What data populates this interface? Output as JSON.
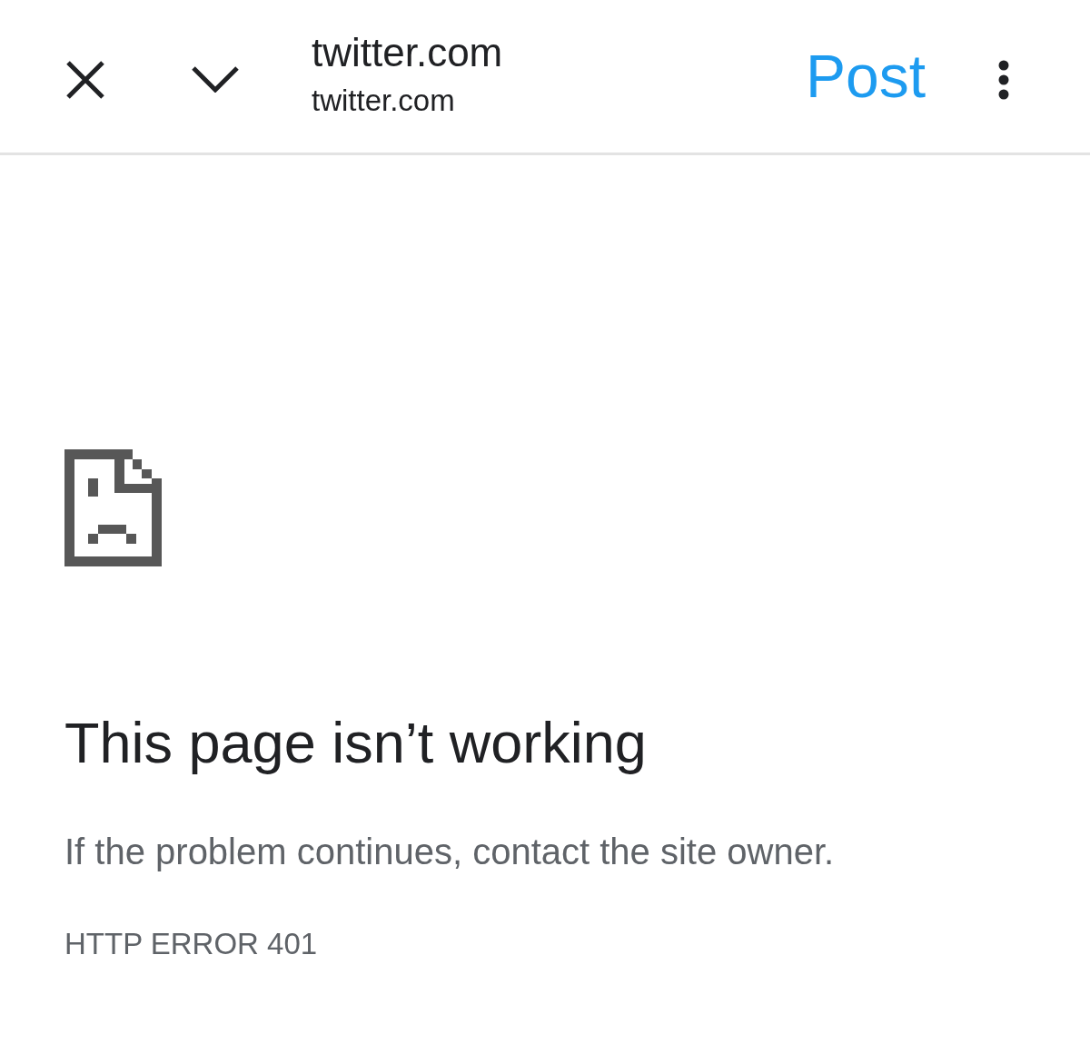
{
  "toolbar": {
    "title": "twitter.com",
    "url": "twitter.com",
    "action": "Post"
  },
  "error": {
    "heading": "This page isn’t working",
    "message": "If the problem continues, contact the site owner.",
    "code": "HTTP ERROR 401"
  }
}
